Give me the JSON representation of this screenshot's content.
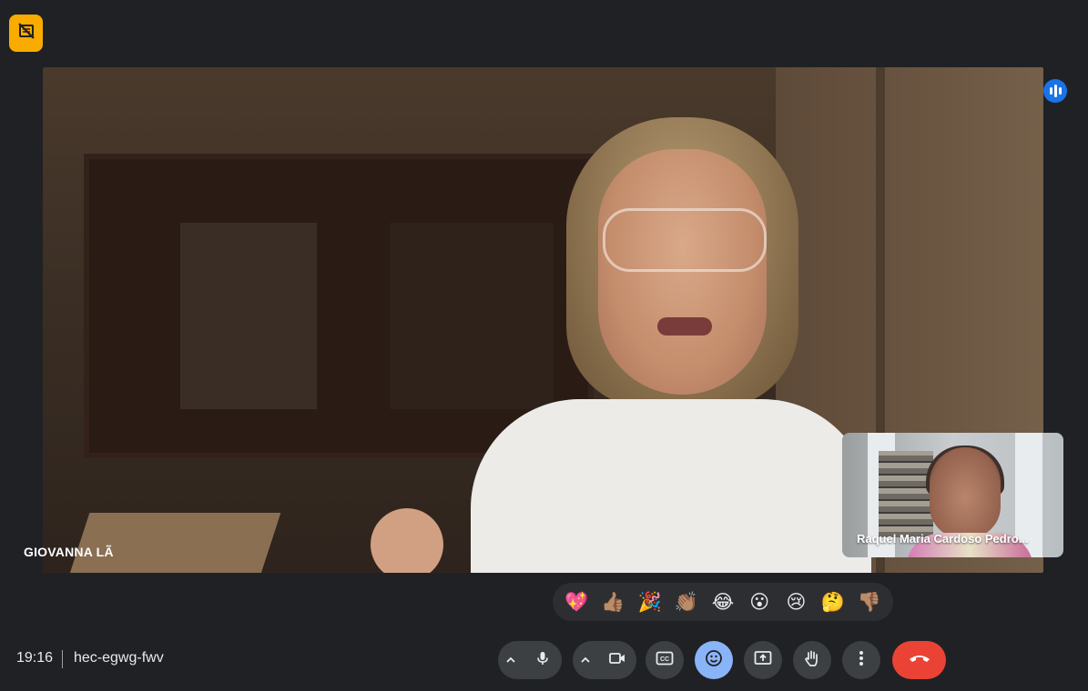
{
  "main_participant": {
    "name": "GIOVANNA LÃ"
  },
  "self_view": {
    "name": "Raquel Maria Cardoso Pedro..."
  },
  "reactions": [
    {
      "icon": "sparkling-heart-icon",
      "glyph": "💖"
    },
    {
      "icon": "thumbs-up-icon",
      "glyph": "👍🏽"
    },
    {
      "icon": "party-popper-icon",
      "glyph": "🎉"
    },
    {
      "icon": "clapping-hands-icon",
      "glyph": "👏🏽"
    },
    {
      "icon": "tears-of-joy-icon",
      "glyph": "😂"
    },
    {
      "icon": "surprised-face-icon",
      "glyph": "😮"
    },
    {
      "icon": "sad-face-icon",
      "glyph": "😢"
    },
    {
      "icon": "thinking-face-icon",
      "glyph": "🤔"
    },
    {
      "icon": "thumbs-down-icon",
      "glyph": "👎🏽"
    }
  ],
  "footer": {
    "time": "19:16",
    "meeting_code": "hec-egwg-fwv"
  },
  "controls": [
    {
      "icon": "chevron-up-icon"
    },
    {
      "icon": "microphone-icon"
    },
    {
      "icon": "chevron-up-icon"
    },
    {
      "icon": "camera-icon"
    },
    {
      "icon": "captions-icon"
    },
    {
      "icon": "emoji-icon"
    },
    {
      "icon": "present-screen-icon"
    },
    {
      "icon": "raise-hand-icon"
    },
    {
      "icon": "more-options-icon"
    },
    {
      "icon": "end-call-icon"
    }
  ],
  "colors": {
    "background": "#202124",
    "control": "#3c4043",
    "active_control": "#8ab4f8",
    "end_call": "#ea4335",
    "badge": "#f9ab00",
    "speaking": "#1a73e8"
  }
}
